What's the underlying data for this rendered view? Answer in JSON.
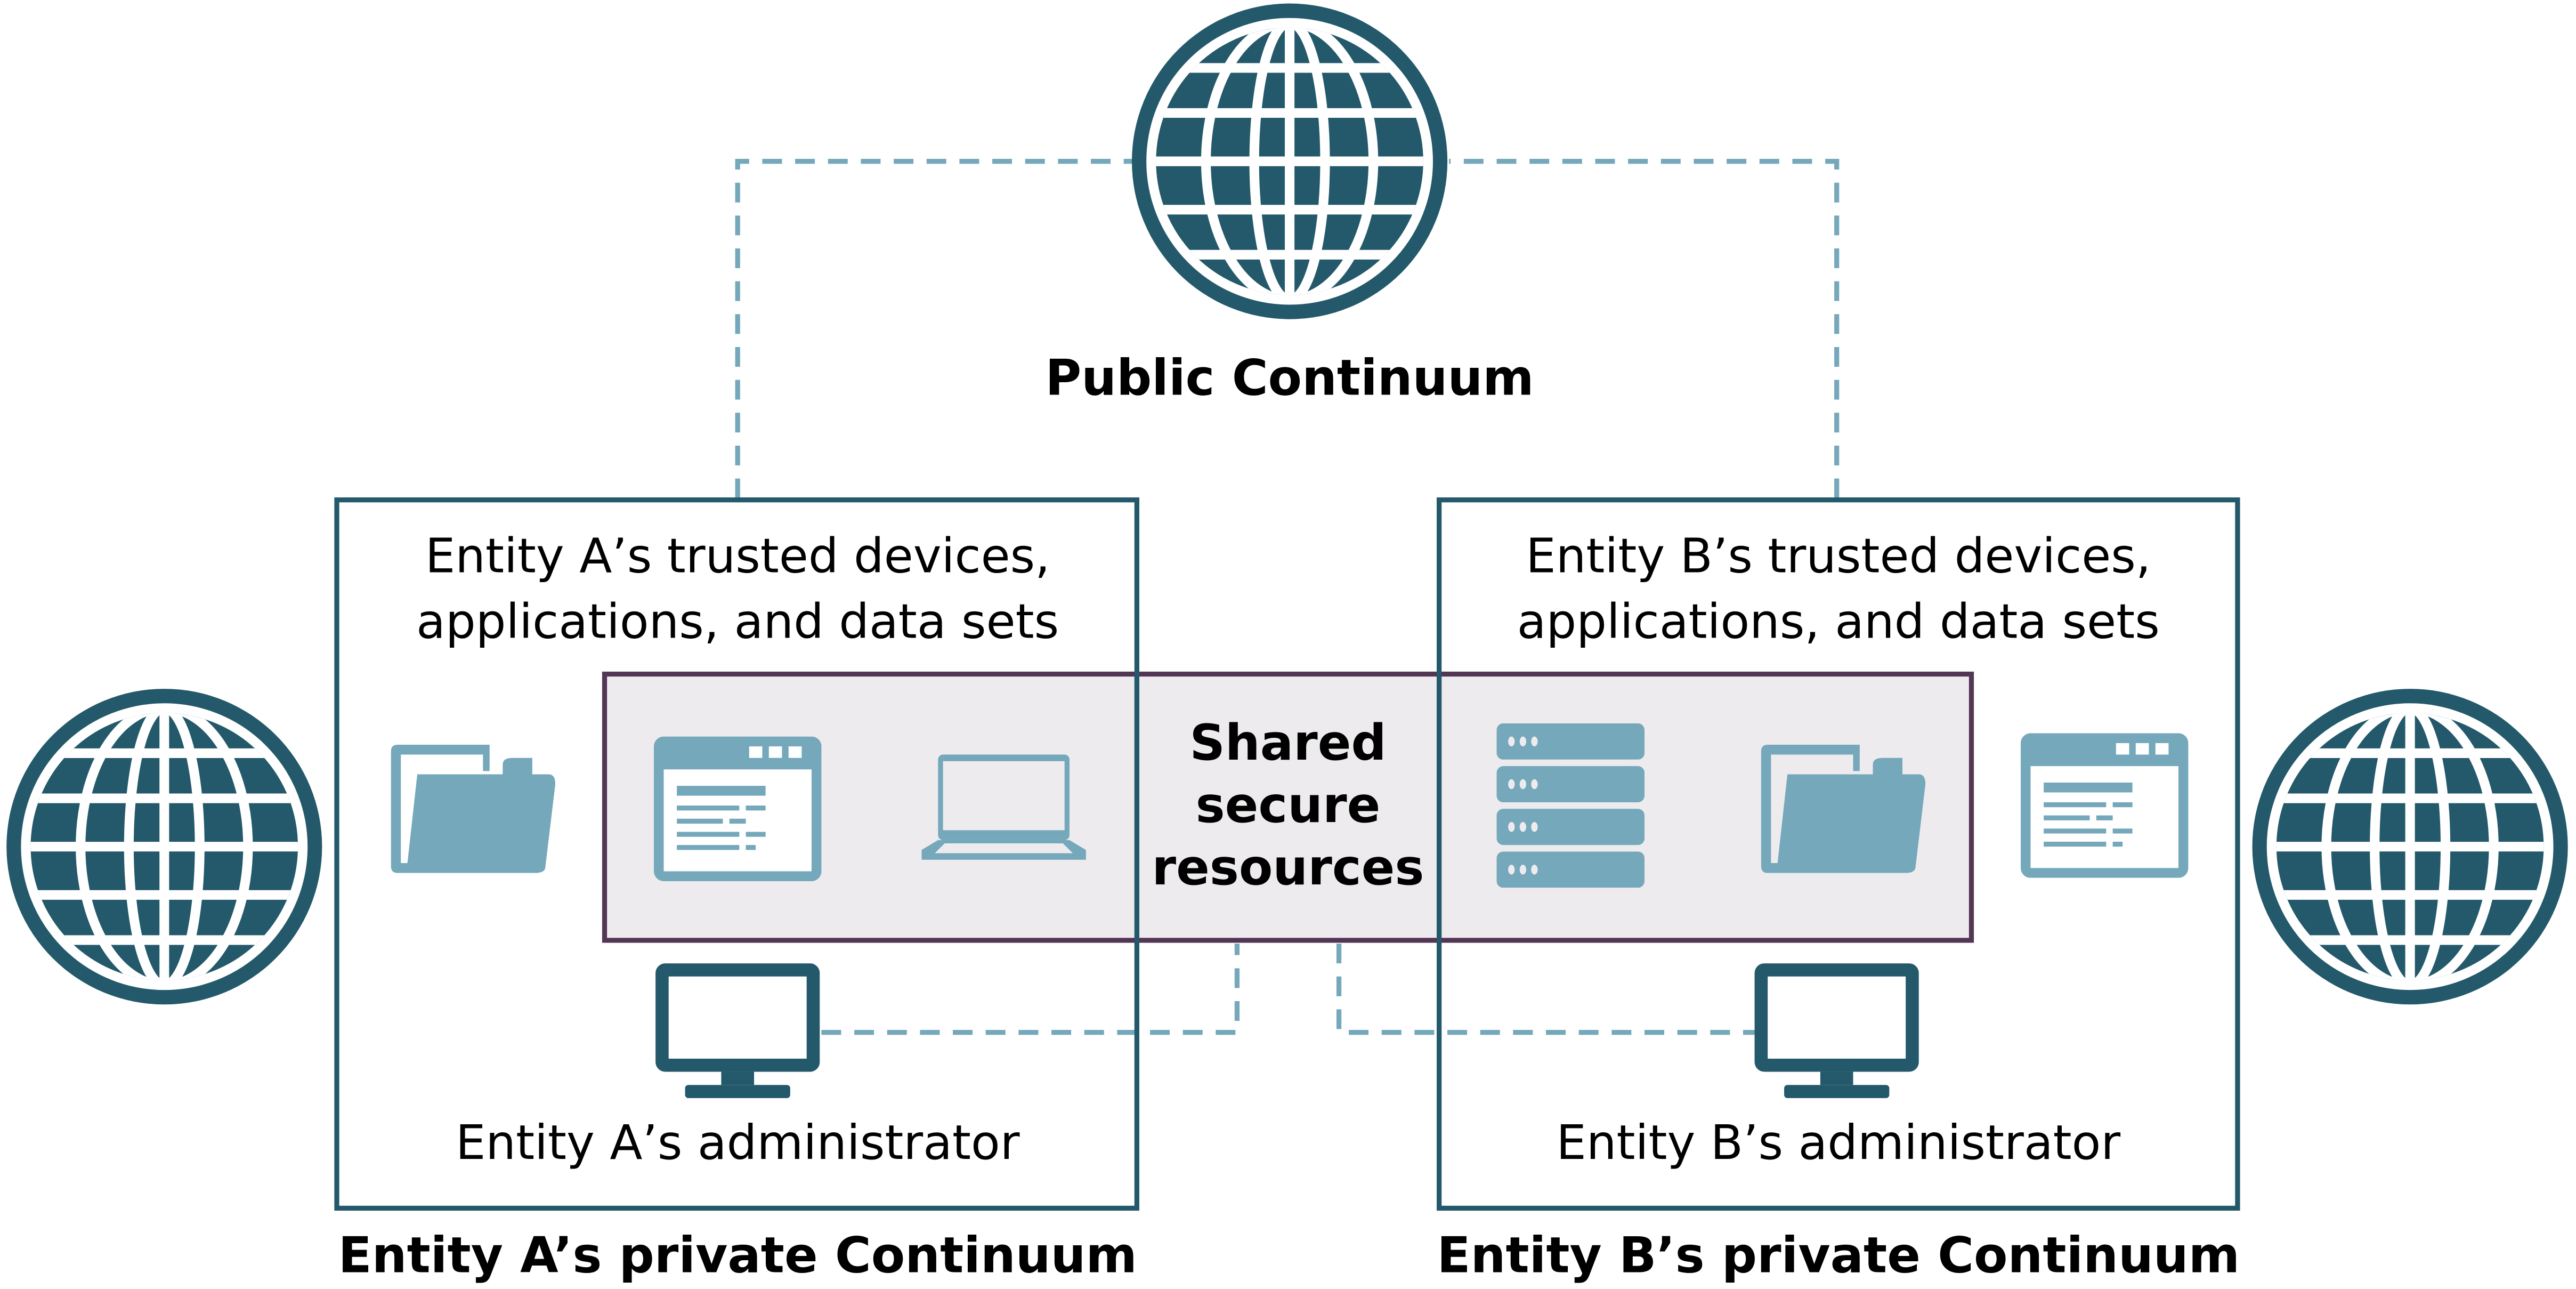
{
  "public": {
    "label": "Public Continuum"
  },
  "entity_a": {
    "trusted_line1": "Entity A’s trusted devices,",
    "trusted_line2": "applications, and data sets",
    "admin": "Entity A’s administrator",
    "continuum": "Entity A’s private Continuum"
  },
  "entity_b": {
    "trusted_line1": "Entity B’s trusted devices,",
    "trusted_line2": "applications, and data sets",
    "admin": "Entity B’s administrator",
    "continuum": "Entity B’s private Continuum"
  },
  "shared": {
    "line1": "Shared",
    "line2": "secure",
    "line3": "resources"
  },
  "colors": {
    "dark_teal": "#23596a",
    "light_teal": "#74a8ba",
    "purple": "#523654",
    "shared_fill": "#edebee"
  },
  "icons": [
    "globe-icon",
    "folder-icon",
    "browser-window-icon",
    "laptop-icon",
    "server-stack-icon",
    "monitor-icon"
  ]
}
